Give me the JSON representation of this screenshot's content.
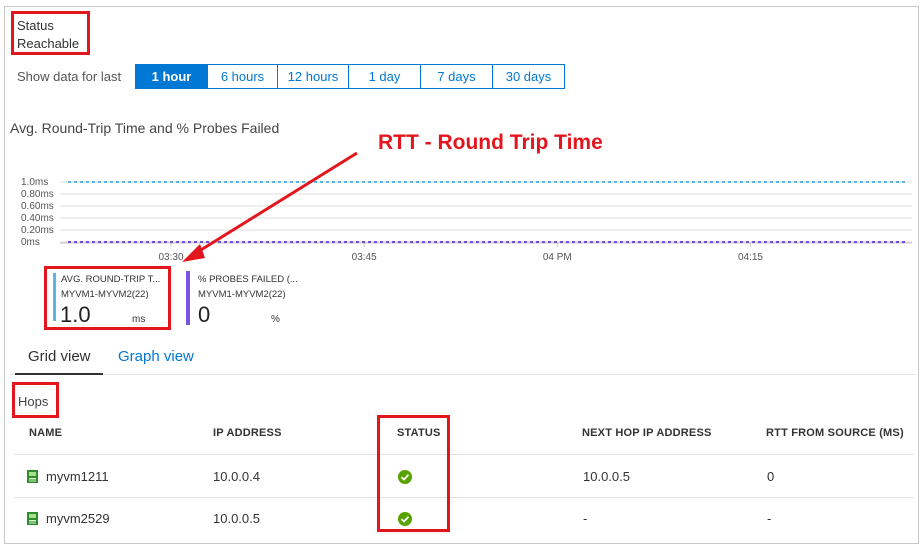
{
  "status": {
    "heading": "Status",
    "value": "Reachable"
  },
  "time_range": {
    "label": "Show data for last",
    "options": [
      "1 hour",
      "6 hours",
      "12 hours",
      "1 day",
      "7 days",
      "30 days"
    ],
    "selected": "1 hour"
  },
  "chart": {
    "title": "Avg. Round-Trip Time and % Probes Failed"
  },
  "annotation": {
    "text": "RTT - Round Trip Time"
  },
  "chart_data": {
    "type": "line",
    "title": "Avg. Round-Trip Time and % Probes Failed",
    "y_tick_labels": [
      "1.0ms",
      "0.80ms",
      "0.60ms",
      "0.40ms",
      "0.20ms",
      "0ms"
    ],
    "y_ticks": [
      1.0,
      0.8,
      0.6,
      0.4,
      0.2,
      0
    ],
    "ylim": [
      0,
      1.0
    ],
    "x_tick_labels": [
      "03:30",
      "03:45",
      "04 PM",
      "04:15"
    ],
    "x_tick_positions_min": [
      0,
      15,
      30,
      45
    ],
    "xlim_min": [
      -8,
      57
    ],
    "grid": true,
    "series": [
      {
        "name": "AVG. ROUND-TRIP TIME",
        "color": "#5bb4e5",
        "x": [
          -8,
          57
        ],
        "y": [
          1.0,
          1.0
        ]
      },
      {
        "name": "% PROBES FAILED",
        "color": "#6e4ed7",
        "x": [
          -8,
          57
        ],
        "y": [
          0,
          0
        ]
      }
    ]
  },
  "legend": [
    {
      "title": "AVG. ROUND-TRIP T...",
      "sub": "MYVM1-MYVM2(22)",
      "value": "1.0",
      "unit": "ms",
      "color": "#5bb4e5"
    },
    {
      "title": "% PROBES FAILED (...",
      "sub": "MYVM1-MYVM2(22)",
      "value": "0",
      "unit": "%",
      "color": "#7a55e0"
    }
  ],
  "tabs": {
    "grid": "Grid view",
    "graph": "Graph view"
  },
  "hops": {
    "label": "Hops",
    "columns": [
      "NAME",
      "IP ADDRESS",
      "STATUS",
      "NEXT HOP IP ADDRESS",
      "RTT FROM SOURCE (MS)"
    ],
    "rows": [
      {
        "name": "myvm1211",
        "ip": "10.0.0.4",
        "status": "ok",
        "next_hop": "10.0.0.5",
        "rtt": "0"
      },
      {
        "name": "myvm2529",
        "ip": "10.0.0.5",
        "status": "ok",
        "next_hop": "-",
        "rtt": "-"
      }
    ]
  },
  "colors": {
    "accent": "#0078d4",
    "annotation_red": "#e3161e",
    "ok_green": "#57a300",
    "vm_green": "#2e8b2e"
  }
}
